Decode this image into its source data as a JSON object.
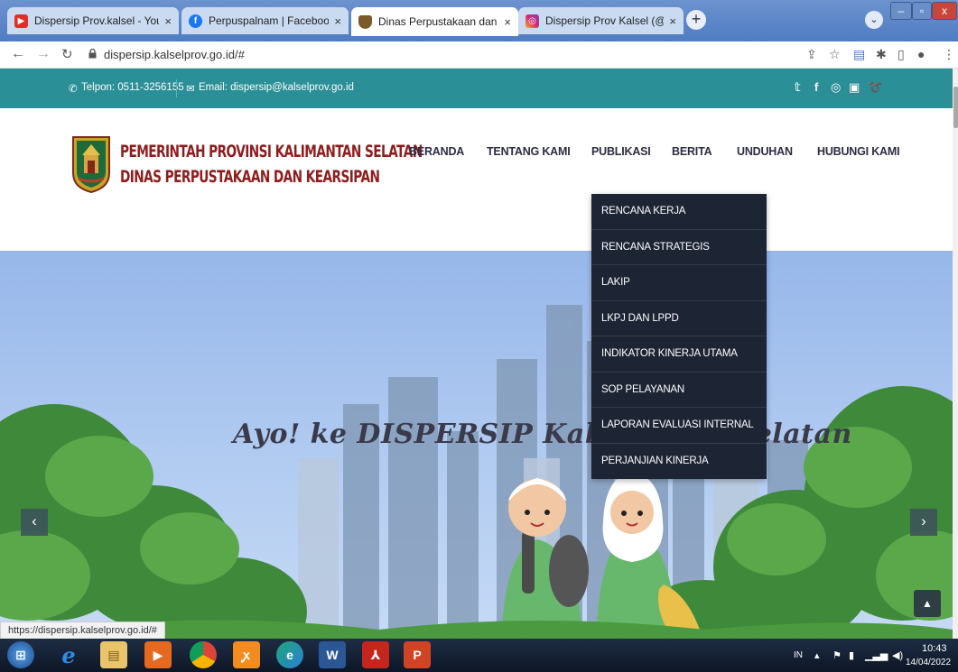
{
  "browser": {
    "tabs": [
      {
        "title": "Dispersip Prov.kalsel - YouTube",
        "icon": "youtube-icon",
        "color": "#e52d27"
      },
      {
        "title": "Perpuspalnam | Facebook",
        "icon": "facebook-icon",
        "color": "#1877f2"
      },
      {
        "title": "Dinas Perpustakaan dan Kearsipa",
        "icon": "site-emblem-icon",
        "color": "#7a5a2a"
      },
      {
        "title": "Dispersip Prov Kalsel (@perpusp",
        "icon": "instagram-icon",
        "color": "#d62976"
      }
    ],
    "close_glyph": "×",
    "new_tab_glyph": "+",
    "url": "dispersip.kalselprov.go.id/#",
    "status_url": "https://dispersip.kalselprov.go.id/#"
  },
  "topbar": {
    "phone": "Telpon: 0511-3256155",
    "email": "Email: dispersip@kalselprov.go.id"
  },
  "header": {
    "org_line1": "PEMERINTAH PROVINSI KALIMANTAN SELATAN",
    "org_line2": "DINAS PERPUSTAKAAN DAN KEARSIPAN",
    "menu": [
      "BERANDA",
      "TENTANG KAMI",
      "PUBLIKASI",
      "BERITA",
      "UNDUHAN",
      "HUBUNGI KAMI"
    ]
  },
  "dropdown": {
    "items": [
      "RENCANA KERJA",
      "RENCANA STRATEGIS",
      "LAKIP",
      "LKPJ DAN LPPD",
      "INDIKATOR KINERJA UTAMA",
      "SOP PELAYANAN",
      "LAPORAN EVALUASI INTERNAL",
      "PERJANJIAN KINERJA"
    ]
  },
  "hero": {
    "title": "Ayo! ke DISPERSIP Kalimantan Selatan"
  },
  "taskbar": {
    "lang": "IN",
    "time": "10:43",
    "date": "14/04/2022"
  },
  "colors": {
    "teal": "#2a8f97",
    "brand_red": "#8f1d1d",
    "dropdown_bg": "#1d2433"
  }
}
